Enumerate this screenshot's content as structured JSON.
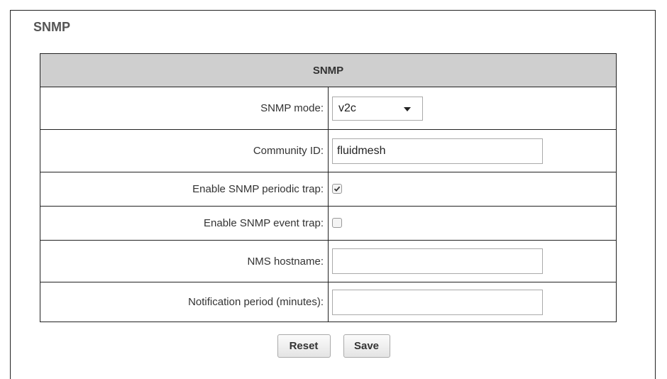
{
  "page": {
    "section_title": "SNMP"
  },
  "table": {
    "header": "SNMP",
    "rows": [
      {
        "label": "SNMP mode:",
        "type": "select",
        "value": "v2c"
      },
      {
        "label": "Community ID:",
        "type": "text",
        "value": "fluidmesh",
        "placeholder": ""
      },
      {
        "label": "Enable SNMP periodic trap:",
        "type": "checkbox",
        "checked": true
      },
      {
        "label": "Enable SNMP event trap:",
        "type": "checkbox",
        "checked": false
      },
      {
        "label": "NMS hostname:",
        "type": "text",
        "value": "",
        "placeholder": ""
      },
      {
        "label": "Notification period (minutes):",
        "type": "text",
        "value": "",
        "placeholder": ""
      }
    ]
  },
  "buttons": {
    "reset_label": "Reset",
    "save_label": "Save"
  },
  "icons": {
    "select_caret": "chevron-down-icon",
    "check": "check-icon"
  },
  "colors": {
    "header_bg": "#cfcfcf",
    "border": "#222222",
    "text": "#333333"
  }
}
